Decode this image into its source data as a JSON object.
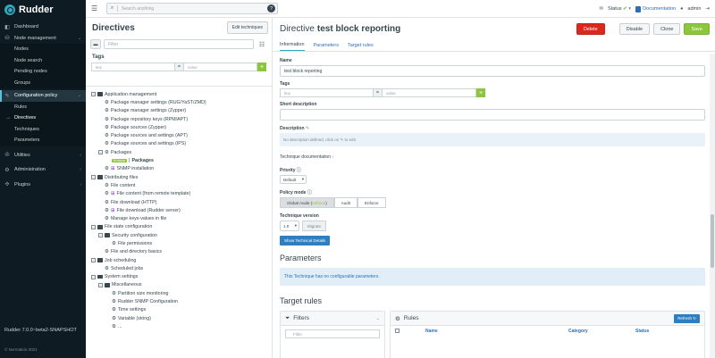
{
  "sidebar": {
    "brand": "Rudder",
    "items": [
      {
        "label": "Dashboard",
        "icon": "dashboard-icon"
      },
      {
        "label": "Node management",
        "icon": "sitemap-icon"
      },
      {
        "label": "Configuration policy",
        "icon": "pencil-icon"
      },
      {
        "label": "Utilities",
        "icon": "wrench-icon"
      },
      {
        "label": "Administration",
        "icon": "gear-icon"
      },
      {
        "label": "Plugins",
        "icon": "puzzle-icon"
      }
    ],
    "node_sub": [
      "Nodes",
      "Node search",
      "Pending nodes",
      "Groups"
    ],
    "config_sub": [
      "Rules",
      "Directives",
      "Techniques",
      "Parameters"
    ],
    "version": "Rudder 7.0.0~beta2-SNAPSHOT",
    "copyright": "© Normation 2021"
  },
  "topbar": {
    "search_placeholder": "Search anything",
    "status_label": "Status",
    "documentation": "Documentation",
    "user": "admin"
  },
  "left": {
    "title": "Directives",
    "edit_button": "Edit techniques",
    "filter_placeholder": "Filter",
    "tags_label": "Tags",
    "key_placeholder": "key",
    "eq": "=",
    "value_placeholder": "value",
    "tree": [
      {
        "label": "Application management",
        "level": 0,
        "type": "folder",
        "exp": "minus"
      },
      {
        "label": "Package manager settings (RUG/YaST/ZMD)",
        "level": 1,
        "type": "gear"
      },
      {
        "label": "Package manager settings (Zypper)",
        "level": 1,
        "type": "gear"
      },
      {
        "label": "Package repository keys (RPM/APT)",
        "level": 1,
        "type": "gear"
      },
      {
        "label": "Package sources (Zypper)",
        "level": 1,
        "type": "gear"
      },
      {
        "label": "Package sources and settings (APT)",
        "level": 1,
        "type": "gear"
      },
      {
        "label": "Package sources and settings (IPS)",
        "level": 1,
        "type": "gear"
      },
      {
        "label": "Packages",
        "level": 1,
        "type": "gear",
        "exp": "minus"
      },
      {
        "label": "Packages",
        "level": 2,
        "type": "badge",
        "badge": "Enforce",
        "sep": "|"
      },
      {
        "label": "SNMP installation",
        "level": 1,
        "type": "gear",
        "win": true
      },
      {
        "label": "Distributing files",
        "level": 0,
        "type": "folder",
        "exp": "minus"
      },
      {
        "label": "File content",
        "level": 1,
        "type": "gear"
      },
      {
        "label": "File content (from remote template)",
        "level": 1,
        "type": "gear",
        "win": true
      },
      {
        "label": "File download (HTTP)",
        "level": 1,
        "type": "gear"
      },
      {
        "label": "File download (Rudder server)",
        "level": 1,
        "type": "gear",
        "win": true
      },
      {
        "label": "Manage keys-values in file",
        "level": 1,
        "type": "gear"
      },
      {
        "label": "File state configuration",
        "level": 0,
        "type": "folder",
        "exp": "minus"
      },
      {
        "label": "Security configuration",
        "level": 1,
        "type": "folder",
        "exp": "minus"
      },
      {
        "label": "File permissions",
        "level": 2,
        "type": "gear"
      },
      {
        "label": "File and directory basics",
        "level": 1,
        "type": "gear"
      },
      {
        "label": "Job scheduling",
        "level": 0,
        "type": "folder",
        "exp": "minus"
      },
      {
        "label": "Scheduled jobs",
        "level": 1,
        "type": "gear"
      },
      {
        "label": "System settings",
        "level": 0,
        "type": "folder",
        "exp": "minus"
      },
      {
        "label": "Miscellaneous",
        "level": 1,
        "type": "folder",
        "exp": "minus"
      },
      {
        "label": "Partition size monitoring",
        "level": 2,
        "type": "gear"
      },
      {
        "label": "Rudder SNMP Configuration",
        "level": 2,
        "type": "gear"
      },
      {
        "label": "Time settings",
        "level": 2,
        "type": "gear"
      },
      {
        "label": "Variable (string)",
        "level": 2,
        "type": "gear"
      },
      {
        "label": "...",
        "level": 2,
        "type": "gear"
      }
    ]
  },
  "right": {
    "title_prefix": "Directive",
    "title_name": "test block reporting",
    "buttons": {
      "delete": "Delete",
      "disable": "Disable",
      "clone": "Clone",
      "save": "Save"
    },
    "tabs": [
      "Information",
      "Parameters",
      "Target rules"
    ],
    "name_label": "Name",
    "name_value": "test block reporting",
    "tags_label": "Tags",
    "short_desc_label": "Short description",
    "description_label": "Description",
    "description_placeholder": "No description defined, click on ✎ to edit",
    "tech_doc_label": "Technique documentation",
    "priority_label": "Priority",
    "priority_value": "Default",
    "policy_mode_label": "Policy mode",
    "modes": [
      "Global mode (",
      "enforce",
      ")",
      "Audit",
      "Enforce"
    ],
    "tech_version_label": "Technique version",
    "version_value": "1.0",
    "migrate": "Migrate",
    "show_tech": "Show Technical Details",
    "params_title": "Parameters",
    "params_info": "This Technique has no configurable parameters.",
    "target_title": "Target rules",
    "filters_title": "Filters",
    "filter_placeholder": "Filter",
    "rules_title": "Rules",
    "refresh": "Refresh",
    "cols": [
      "Name",
      "Category",
      "Status"
    ]
  },
  "colors": {
    "sidebar": "#0e1b22",
    "accent": "#2fa6bc",
    "delete": "#da291c",
    "save": "#8cc63f",
    "link": "#2d6fb6"
  }
}
